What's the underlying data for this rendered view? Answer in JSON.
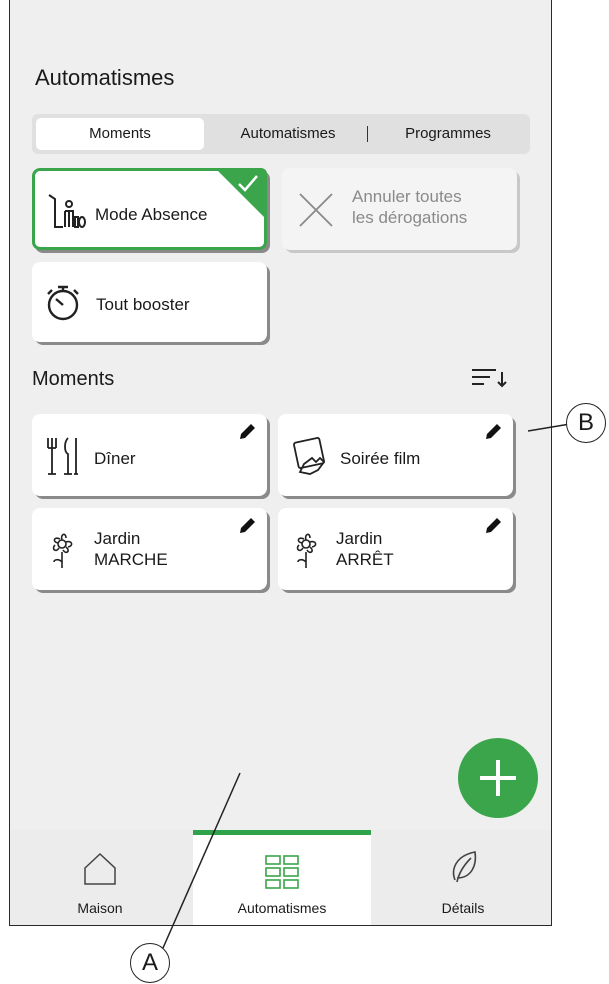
{
  "header": {
    "title": "Automatismes"
  },
  "segmented": {
    "tabs": [
      {
        "label": "Moments",
        "active": true
      },
      {
        "label": "Automatismes",
        "active": false
      },
      {
        "label": "Programmes",
        "active": false
      }
    ]
  },
  "quick_actions": [
    {
      "label": "Mode Absence",
      "icon": "person-away-icon",
      "selected": true
    },
    {
      "label_line1": "Annuler toutes",
      "label_line2": "les dérogations",
      "icon": "close-x-icon",
      "disabled": true
    },
    {
      "label": "Tout booster",
      "icon": "stopwatch-icon"
    }
  ],
  "moments": {
    "title": "Moments",
    "items": [
      {
        "label": "Dîner",
        "icon": "cutlery-icon"
      },
      {
        "label": "Soirée film",
        "icon": "tablet-hand-icon"
      },
      {
        "label_line1": "Jardin",
        "label_line2": "MARCHE",
        "icon": "flower-icon"
      },
      {
        "label_line1": "Jardin",
        "label_line2": "ARRÊT",
        "icon": "flower-icon"
      }
    ]
  },
  "nav": {
    "items": [
      {
        "label": "Maison",
        "icon": "house-icon",
        "active": false
      },
      {
        "label": "Automatismes",
        "icon": "grid-icon",
        "active": true
      },
      {
        "label": "Détails",
        "icon": "leaf-icon",
        "active": false
      }
    ]
  },
  "callouts": {
    "a": "A",
    "b": "B"
  },
  "colors": {
    "accent": "#3aa54a",
    "background": "#efefef"
  }
}
